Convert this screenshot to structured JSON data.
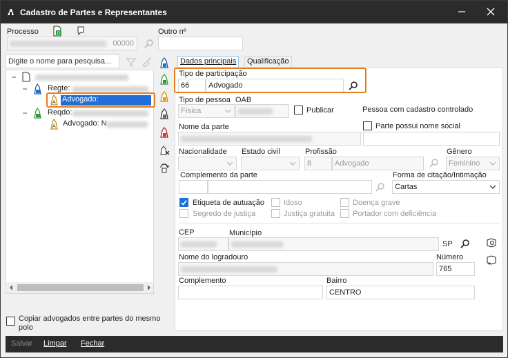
{
  "window": {
    "title": "Cadastro de Partes e Representantes"
  },
  "header": {
    "processo_label": "Processo",
    "processo_suffix": "00000",
    "outro_label": "Outro nº",
    "search_placeholder": "Digite o nome para pesquisa..."
  },
  "tree": {
    "regte_label": "Regte:",
    "advogado_label": "Advogado: ",
    "reqdo_label": "Reqdo:",
    "advogado2_label": "Advogado: N"
  },
  "tabs": {
    "main": "Dados principais",
    "qualif": "Qualificação"
  },
  "form": {
    "tipo_participacao_label": "Tipo de participação",
    "tipo_participacao_code": "66",
    "tipo_participacao_value": "Advogado",
    "tipo_pessoa_label": "Tipo de pessoa",
    "tipo_pessoa_value": "Física",
    "oab_label": "OAB",
    "publicar_label": "Publicar",
    "controlado_label": "Pessoa com cadastro controlado",
    "nome_parte_label": "Nome da parte",
    "nome_social_label": "Parte possui nome social",
    "nacionalidade_label": "Nacionalidade",
    "estado_civil_label": "Estado civil",
    "profissao_label": "Profissão",
    "profissao_code": "8",
    "profissao_value": "Advogado",
    "genero_label": "Gênero",
    "genero_value": "Feminino",
    "complemento_parte_label": "Complemento da parte",
    "forma_citacao_label": "Forma de citação/Intimação",
    "forma_citacao_value": "Cartas",
    "etiqueta_label": "Etiqueta de autuação",
    "idoso_label": "Idoso",
    "doenca_label": "Doença grave",
    "segredo_label": "Segredo de justiça",
    "gratuita_label": "Justiça gratuita",
    "deficiencia_label": "Portador com deficiência",
    "cep_label": "CEP",
    "municipio_label": "Município",
    "uf_value": "SP",
    "logradouro_label": "Nome do logradouro",
    "numero_label": "Número",
    "numero_value": "765",
    "complemento_label": "Complemento",
    "bairro_label": "Bairro",
    "bairro_value": "CENTRO"
  },
  "footer": {
    "copiar_label": "Copiar advogados entre partes do mesmo polo",
    "salvar": "Salvar",
    "limpar": "Limpar",
    "fechar": "Fechar"
  },
  "colors": {
    "accent": "#e57e1f",
    "selection": "#1f6fd6",
    "titlebar": "#2b2b2b"
  }
}
